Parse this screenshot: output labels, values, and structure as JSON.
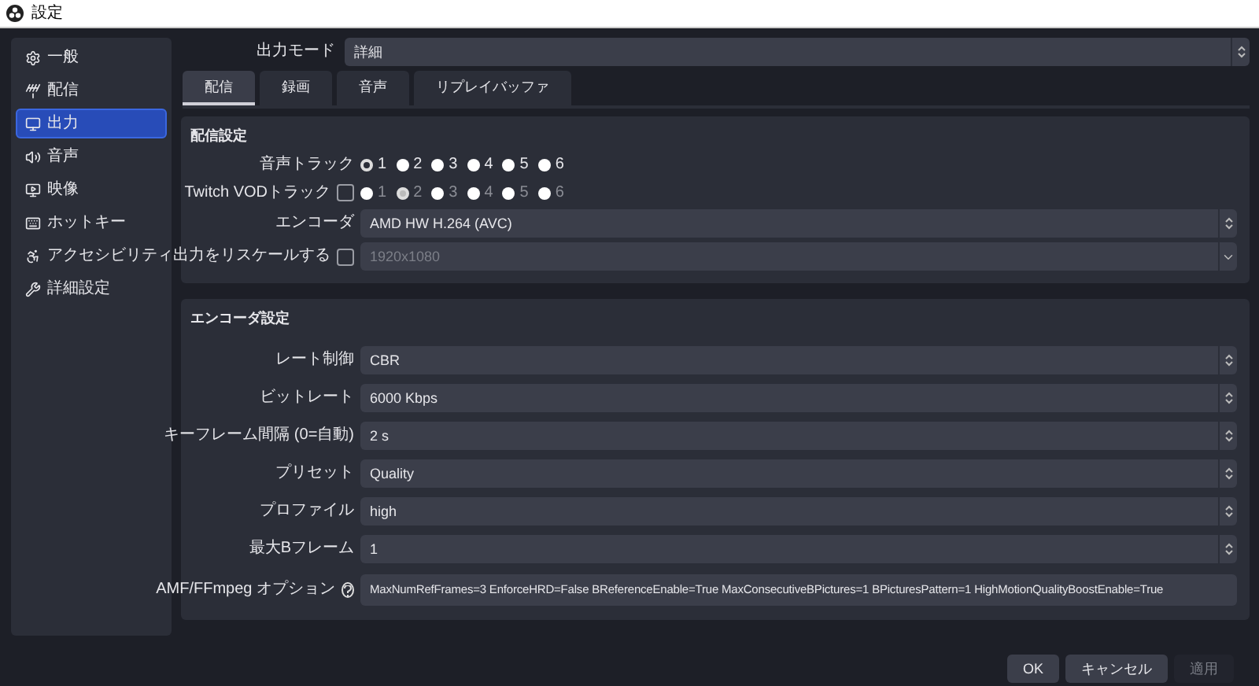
{
  "window": {
    "title": "設定"
  },
  "sidebar": {
    "items": [
      {
        "label": "一般",
        "selected": false
      },
      {
        "label": "配信",
        "selected": false
      },
      {
        "label": "出力",
        "selected": true
      },
      {
        "label": "音声",
        "selected": false
      },
      {
        "label": "映像",
        "selected": false
      },
      {
        "label": "ホットキー",
        "selected": false
      },
      {
        "label": "アクセシビリティ",
        "selected": false
      },
      {
        "label": "詳細設定",
        "selected": false
      }
    ]
  },
  "output_mode": {
    "label": "出力モード",
    "value": "詳細"
  },
  "tabs": [
    {
      "label": "配信",
      "selected": true
    },
    {
      "label": "録画",
      "selected": false
    },
    {
      "label": "音声",
      "selected": false
    },
    {
      "label": "リプレイバッファ",
      "selected": false
    }
  ],
  "stream_settings": {
    "title": "配信設定",
    "rows": [
      {
        "kind": "radios",
        "label": "音声トラック",
        "options": [
          {
            "label": "1",
            "selected": true
          },
          {
            "label": "2",
            "selected": false
          },
          {
            "label": "3",
            "selected": false
          },
          {
            "label": "4",
            "selected": false
          },
          {
            "label": "5",
            "selected": false
          },
          {
            "label": "6",
            "selected": false
          }
        ]
      },
      {
        "kind": "check-radios",
        "label": "Twitch VODトラック",
        "checked": false,
        "disabled": true,
        "options": [
          {
            "label": "1",
            "selected": false
          },
          {
            "label": "2",
            "selected": true
          },
          {
            "label": "3",
            "selected": false
          },
          {
            "label": "4",
            "selected": false
          },
          {
            "label": "5",
            "selected": false
          },
          {
            "label": "6",
            "selected": false
          }
        ]
      },
      {
        "kind": "select",
        "label": "エンコーダ",
        "value": "AMD HW H.264 (AVC)"
      },
      {
        "kind": "check-combo",
        "label": "出力をリスケールする",
        "checked": false,
        "value": "1920x1080",
        "disabled": true
      }
    ]
  },
  "encoder_settings": {
    "title": "エンコーダ設定",
    "rows": [
      {
        "kind": "select",
        "label": "レート制御",
        "value": "CBR"
      },
      {
        "kind": "spin",
        "label": "ビットレート",
        "value": "6000 Kbps"
      },
      {
        "kind": "spin",
        "label": "キーフレーム間隔 (0=自動)",
        "value": "2 s"
      },
      {
        "kind": "select",
        "label": "プリセット",
        "value": "Quality"
      },
      {
        "kind": "select",
        "label": "プロファイル",
        "value": "high"
      },
      {
        "kind": "spin",
        "label": "最大Bフレーム",
        "value": "1"
      },
      {
        "kind": "text",
        "label": "AMF/FFmpeg オプション",
        "value": "MaxNumRefFrames=3 EnforceHRD=False BReferenceEnable=True MaxConsecutiveBPictures=1 BPicturesPattern=1 HighMotionQualityBoostEnable=True"
      }
    ]
  },
  "buttons": [
    {
      "label": "OK",
      "disabled": false
    },
    {
      "label": "キャンセル",
      "disabled": false
    },
    {
      "label": "適用",
      "disabled": true
    }
  ]
}
